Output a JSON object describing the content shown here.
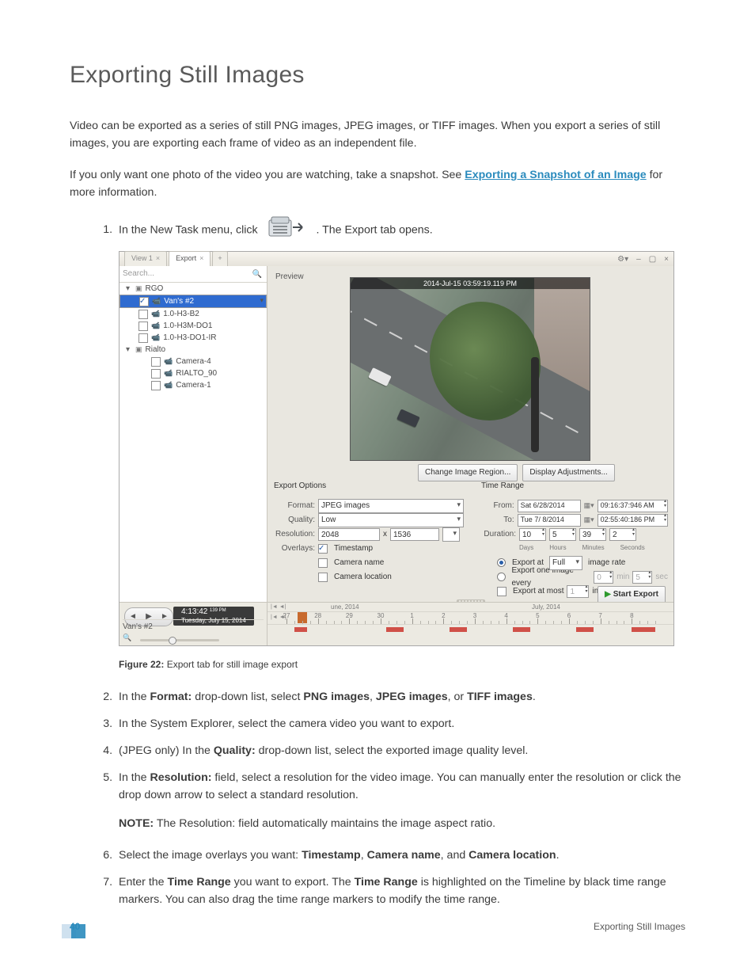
{
  "heading": "Exporting Still Images",
  "para1": "Video can be exported as a series of still PNG images, JPEG images, or TIFF images. When you export a series of still images, you are exporting each frame of video as an independent file.",
  "para2a": "If you only want one photo of the video you are watching, take a snapshot. See ",
  "para2link": "Exporting a Snapshot of an Image",
  "para2b": " for more information.",
  "step1a": "In the New Task menu, click ",
  "step1b": ". The Export tab opens.",
  "figcap_lbl": "Figure 22:",
  "figcap_txt": " Export tab for still image export",
  "step2a": "In the ",
  "step2b": "Format:",
  "step2c": " drop-down list, select ",
  "step2d": "PNG images",
  "step2e": ", ",
  "step2f": "JPEG images",
  "step2g": ", or ",
  "step2h": "TIFF images",
  "step2i": ".",
  "step3": "In the System Explorer, select the camera video you want to export.",
  "step4a": "(JPEG only) In the ",
  "step4b": "Quality:",
  "step4c": " drop-down list, select the exported image quality level.",
  "step5a": "In the ",
  "step5b": "Resolution:",
  "step5c": " field, select a resolution for the video image. You can manually enter the resolution or click the drop down arrow to select a standard resolution.",
  "step5note_lbl": "NOTE:",
  "step5note_txt": " The Resolution: field automatically maintains the image aspect ratio.",
  "step6a": "Select the image overlays you want: ",
  "step6b": "Timestamp",
  "step6c": ", ",
  "step6d": "Camera name",
  "step6e": ", and ",
  "step6f": "Camera location",
  "step6g": ".",
  "step7a": "Enter the ",
  "step7b": "Time Range",
  "step7c": " you want to export. The ",
  "step7d": "Time Range",
  "step7e": " is highlighted on the Timeline by black time range markers. You can also drag the time range markers to modify the time range.",
  "footer_page": "40",
  "footer_title": "Exporting Still Images",
  "app": {
    "tabs": {
      "view": "View 1",
      "export": "Export",
      "plus": "+"
    },
    "close_x": "×",
    "wctl_gear": "⚙▾",
    "wctl_min": "–",
    "wctl_max": "▢",
    "wctl_close": "×",
    "search_placeholder": "Search...",
    "tree": {
      "site1": "RGO",
      "cam1": "Van's #2",
      "cam2": "1.0-H3-B2",
      "cam3": "1.0-H3M-DO1",
      "cam4": "1.0-H3-DO1-IR",
      "site2": "Rialto",
      "cam5": "Camera-4",
      "cam6": "RIALTO_90",
      "cam7": "Camera-1"
    },
    "preview_lbl": "Preview",
    "overlay_ts": "2014-Jul-15 03:59:19.119 PM",
    "btn_region": "Change Image Region...",
    "btn_display": "Display Adjustments...",
    "eo": {
      "title": "Export Options",
      "format_lbl": "Format:",
      "format_val": "JPEG images",
      "quality_lbl": "Quality:",
      "quality_val": "Low",
      "res_lbl": "Resolution:",
      "res_w": "2048",
      "res_x": "x",
      "res_h": "1536",
      "ov_lbl": "Overlays:",
      "ov_ts": "Timestamp",
      "ov_cn": "Camera name",
      "ov_cl": "Camera location"
    },
    "tr": {
      "title": "Time Range",
      "from_lbl": "From:",
      "from_day": "Sat   6/28/2014",
      "from_time": "09:16:37:946  AM",
      "to_lbl": "To:",
      "to_day": "Tue   7/ 8/2014",
      "to_time": "02:55:40:186  PM",
      "dur_lbl": "Duration:",
      "d_days": "10",
      "d_hours": "5",
      "d_min": "39",
      "d_sec": "2",
      "h_days": "Days",
      "h_hours": "Hours",
      "h_min": "Minutes",
      "h_sec": "Seconds",
      "r1a": "Export at ",
      "r1sel": "Full",
      "r1b": " image rate",
      "r2a": "Export one image every ",
      "r2min": "0",
      "r2minlab": "min",
      "r2sec": "5",
      "r2seclab": "sec",
      "r3a": "Export at most ",
      "r3val": "1",
      "r3b": " images"
    },
    "start": "Start Export",
    "tl": {
      "nudge_back": "|◄  ◄|",
      "nudge_fwd": "|◄  ◄|",
      "time_main": "4:13:42",
      "time_ampm": "139  PM",
      "time_sub": "Tuesday, July 15, 2014",
      "camrow": "Van's #2",
      "month1": "une, 2014",
      "month2": "July, 2014",
      "days": [
        "27",
        "28",
        "29",
        "30",
        "1",
        "2",
        "3",
        "4",
        "5",
        "6",
        "7",
        "8"
      ]
    }
  }
}
